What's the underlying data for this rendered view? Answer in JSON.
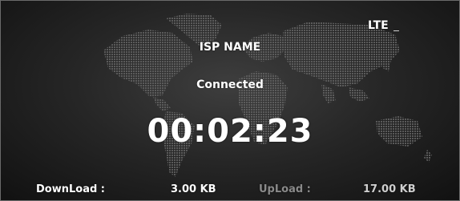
{
  "panel": {
    "network_type": "LTE",
    "isp_name": "ISP NAME",
    "connection_status": "Connected",
    "connection_timer": "00:02:23"
  },
  "traffic": {
    "download_label": "DownLoad :",
    "download_value": "3.00 KB",
    "upload_label": "UpLoad :",
    "upload_value": "17.00 KB"
  },
  "theme": {
    "background": "#262626",
    "text_primary": "#ffffff",
    "text_muted": "#8a8a8a",
    "map_color": "#5a5a5a",
    "map_icon": "world-map-icon"
  }
}
